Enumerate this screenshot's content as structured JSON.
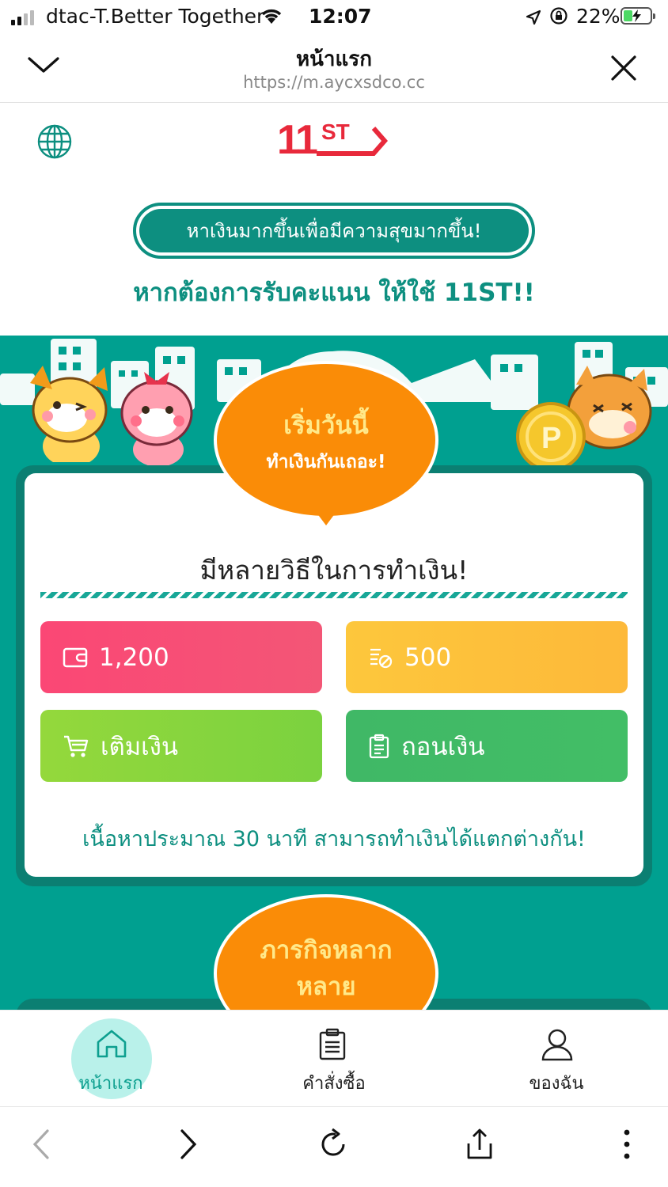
{
  "status_bar": {
    "carrier": "dtac-T.Better Together",
    "time": "12:07",
    "battery": "22%"
  },
  "browser": {
    "title": "หน้าแรก",
    "url": "https://m.aycxsdco.cc"
  },
  "site": {
    "logo_number": "11",
    "logo_letters": "ST",
    "promo_pill": "หาเงินมากขึ้นเพื่อมีความสุขมากขึ้น!",
    "promo_subtitle": "หากต้องการรับคะแนน ให้ใช้ 11ST!!"
  },
  "bubble": {
    "title": "เริ่มวันนี้",
    "subtitle": "ทำเงินกันเถอะ!"
  },
  "card": {
    "title": "มีหลายวิธีในการทำเงิน!",
    "tiles": {
      "balance": "1,200",
      "points": "500",
      "deposit": "เติมเงิน",
      "withdraw": "ถอนเงิน"
    },
    "note": "เนื้อหาประมาณ 30 นาที สามารถทำเงินได้แตกต่างกัน!"
  },
  "bubble2": {
    "title": "ภารกิจหลากหลาย"
  },
  "bottom_nav": {
    "home": "หน้าแรก",
    "orders": "คำสั่งซื้อ",
    "me": "ของฉัน"
  },
  "colors": {
    "teal": "#00a090",
    "brand_red": "#e8293b",
    "orange": "#fa8c07",
    "pink": "#fb4775",
    "yellow": "#fdc73c",
    "lime": "#94d83c",
    "green": "#40b866"
  }
}
